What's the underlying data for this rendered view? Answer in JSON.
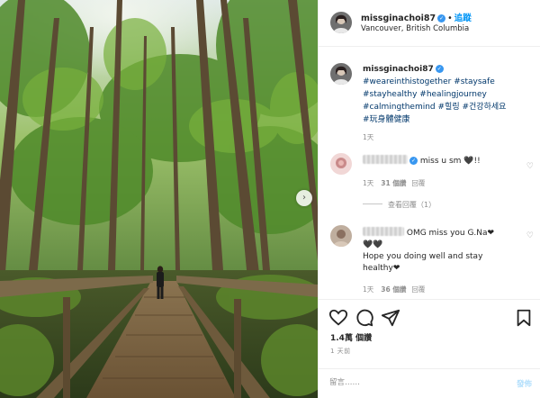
{
  "post": {
    "username": "missginachoi87",
    "follow_label": "追蹤",
    "location": "Vancouver, British Columbia",
    "caption_lines": [
      "#weareinthistogether #staysafe",
      "#stayhealthy #healingjourney",
      "#calmingthemind #힐링 #건강하세요",
      "#玩身體健康"
    ],
    "caption_time": "1天"
  },
  "comments": [
    {
      "text": "miss u sm 🖤!!",
      "time": "1天",
      "likes": "31 個讚",
      "reply_label": "回覆"
    },
    {
      "text_line1": "OMG miss you G.Na❤",
      "text_line2": "🖤🖤",
      "text_line3": "Hope you doing well and stay",
      "text_line4": "healthy❤",
      "time": "1天",
      "likes": "36 個讚",
      "reply_label": "回覆"
    }
  ],
  "view_replies_label": "查看回覆（1）",
  "likes_count": "1.4萬 個讚",
  "post_time": "1 天前",
  "composer": {
    "placeholder": "留言……",
    "post_label": "發佈"
  },
  "colors": {
    "accent": "#0095f6",
    "hashtag": "#00376b",
    "muted": "#8e8e8e",
    "verified": "#3897f0"
  },
  "icons": [
    "verified-badge-icon",
    "chevron-right-icon",
    "heart-icon",
    "comment-icon",
    "share-icon",
    "bookmark-icon"
  ]
}
